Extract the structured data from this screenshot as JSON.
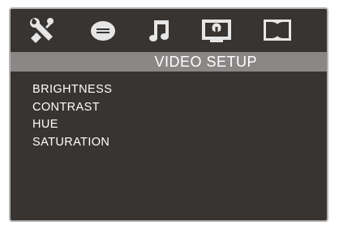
{
  "tabs": [
    {
      "icon": "tools-icon",
      "selected": false
    },
    {
      "icon": "disc-icon",
      "selected": false
    },
    {
      "icon": "music-note-icon",
      "selected": false
    },
    {
      "icon": "video-monitor-icon",
      "selected": true
    },
    {
      "icon": "dolby-icon",
      "selected": false
    }
  ],
  "header": {
    "title": "VIDEO SETUP"
  },
  "menu": {
    "items": [
      {
        "label": "BRIGHTNESS"
      },
      {
        "label": "CONTRAST"
      },
      {
        "label": "HUE"
      },
      {
        "label": "SATURATION"
      }
    ]
  },
  "colors": {
    "panel_background": "#373432",
    "title_bar": "#8a8786",
    "text": "#ffffff",
    "icon": "#e6e6e6"
  }
}
